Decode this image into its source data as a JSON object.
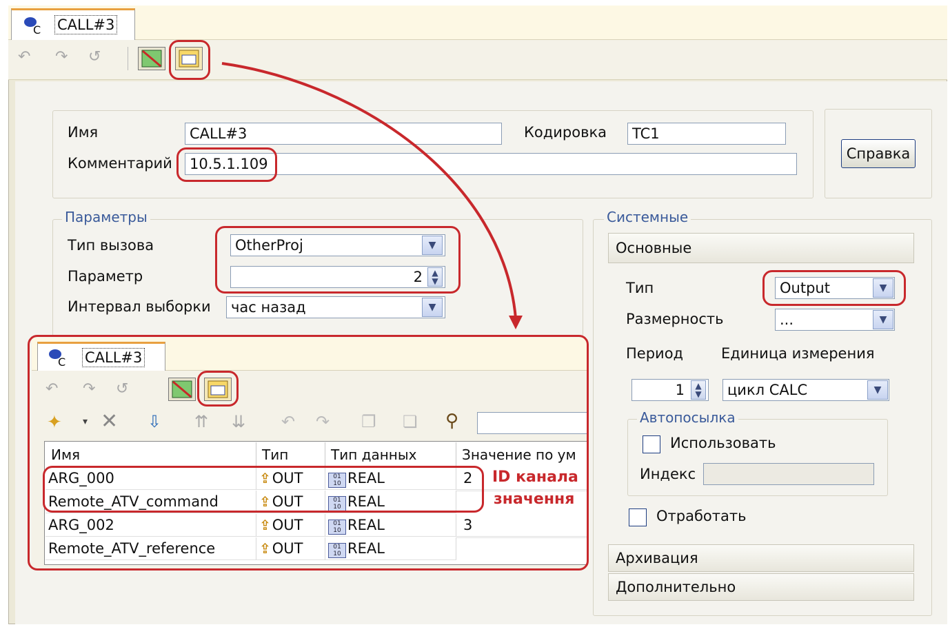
{
  "main_tab": {
    "label": "CALL#3"
  },
  "inner_tab": {
    "label": "CALL#3"
  },
  "top_form": {
    "name_label": "Имя",
    "name_value": "CALL#3",
    "encoding_label": "Кодировка",
    "encoding_value": "TC1",
    "comment_label": "Комментарий",
    "comment_value": "10.5.1.109",
    "help_button": "Справка"
  },
  "params": {
    "group_label": "Параметры",
    "call_type_label": "Тип вызова",
    "call_type_value": "OtherProj",
    "param_label": "Параметр",
    "param_value": "2",
    "interval_label": "Интервал выборки",
    "interval_value": "час назад"
  },
  "system": {
    "group_label": "Системные",
    "basic_section": "Основные",
    "type_label": "Тип",
    "type_value": "Output",
    "dimension_label": "Размерность",
    "dimension_value": "...",
    "period_label": "Период",
    "unit_label": "Единица измерения",
    "period_value": "1",
    "unit_value": "цикл CALC",
    "autosend_group": "Автопосылка",
    "use_label": "Использовать",
    "index_label": "Индекс",
    "index_value": "",
    "process_label": "Отработать",
    "archive_section": "Архивация",
    "additional_section": "Дополнительно"
  },
  "grid": {
    "headers": [
      "Имя",
      "Тип",
      "Тип данных",
      "Значение по ум"
    ],
    "rows": [
      {
        "name": "ARG_000",
        "type": "OUT",
        "dtype": "REAL",
        "value": "2"
      },
      {
        "name": "Remote_ATV_command",
        "type": "OUT",
        "dtype": "REAL",
        "value": ""
      },
      {
        "name": "ARG_002",
        "type": "OUT",
        "dtype": "REAL",
        "value": "3"
      },
      {
        "name": "Remote_ATV_reference",
        "type": "OUT",
        "dtype": "REAL",
        "value": ""
      }
    ]
  },
  "annotations": {
    "line1": "ID канала",
    "line2": "значення"
  },
  "colors": {
    "highlight": "#c8282c",
    "group_title": "#3a5a9a",
    "window_bg": "#ece9d8"
  }
}
